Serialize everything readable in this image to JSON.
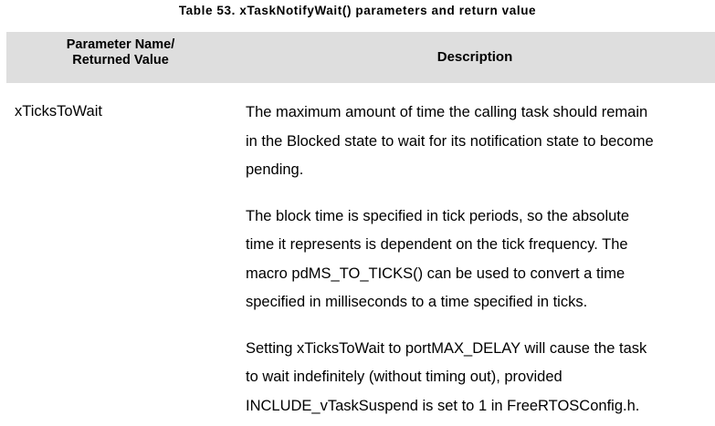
{
  "caption": "Table 53. xTaskNotifyWait() parameters and return value",
  "header": {
    "param_line1": "Parameter Name/",
    "param_line2": "Returned Value",
    "description": "Description"
  },
  "row": {
    "parameter": "xTicksToWait",
    "paragraphs": [
      [
        "The maximum amount of time the calling task should remain",
        "in the Blocked state to wait for its notification state to become",
        "pending."
      ],
      [
        "The block time is specified in tick periods, so the absolute",
        "time it represents is dependent on the tick frequency.  The",
        "macro pdMS_TO_TICKS() can be used to convert a time",
        "specified in milliseconds to a time specified in ticks."
      ],
      [
        "Setting xTicksToWait to portMAX_DELAY will cause the task",
        "to wait indefinitely (without timing out), provided",
        "INCLUDE_vTaskSuspend is set to 1 in FreeRTOSConfig.h."
      ]
    ]
  }
}
